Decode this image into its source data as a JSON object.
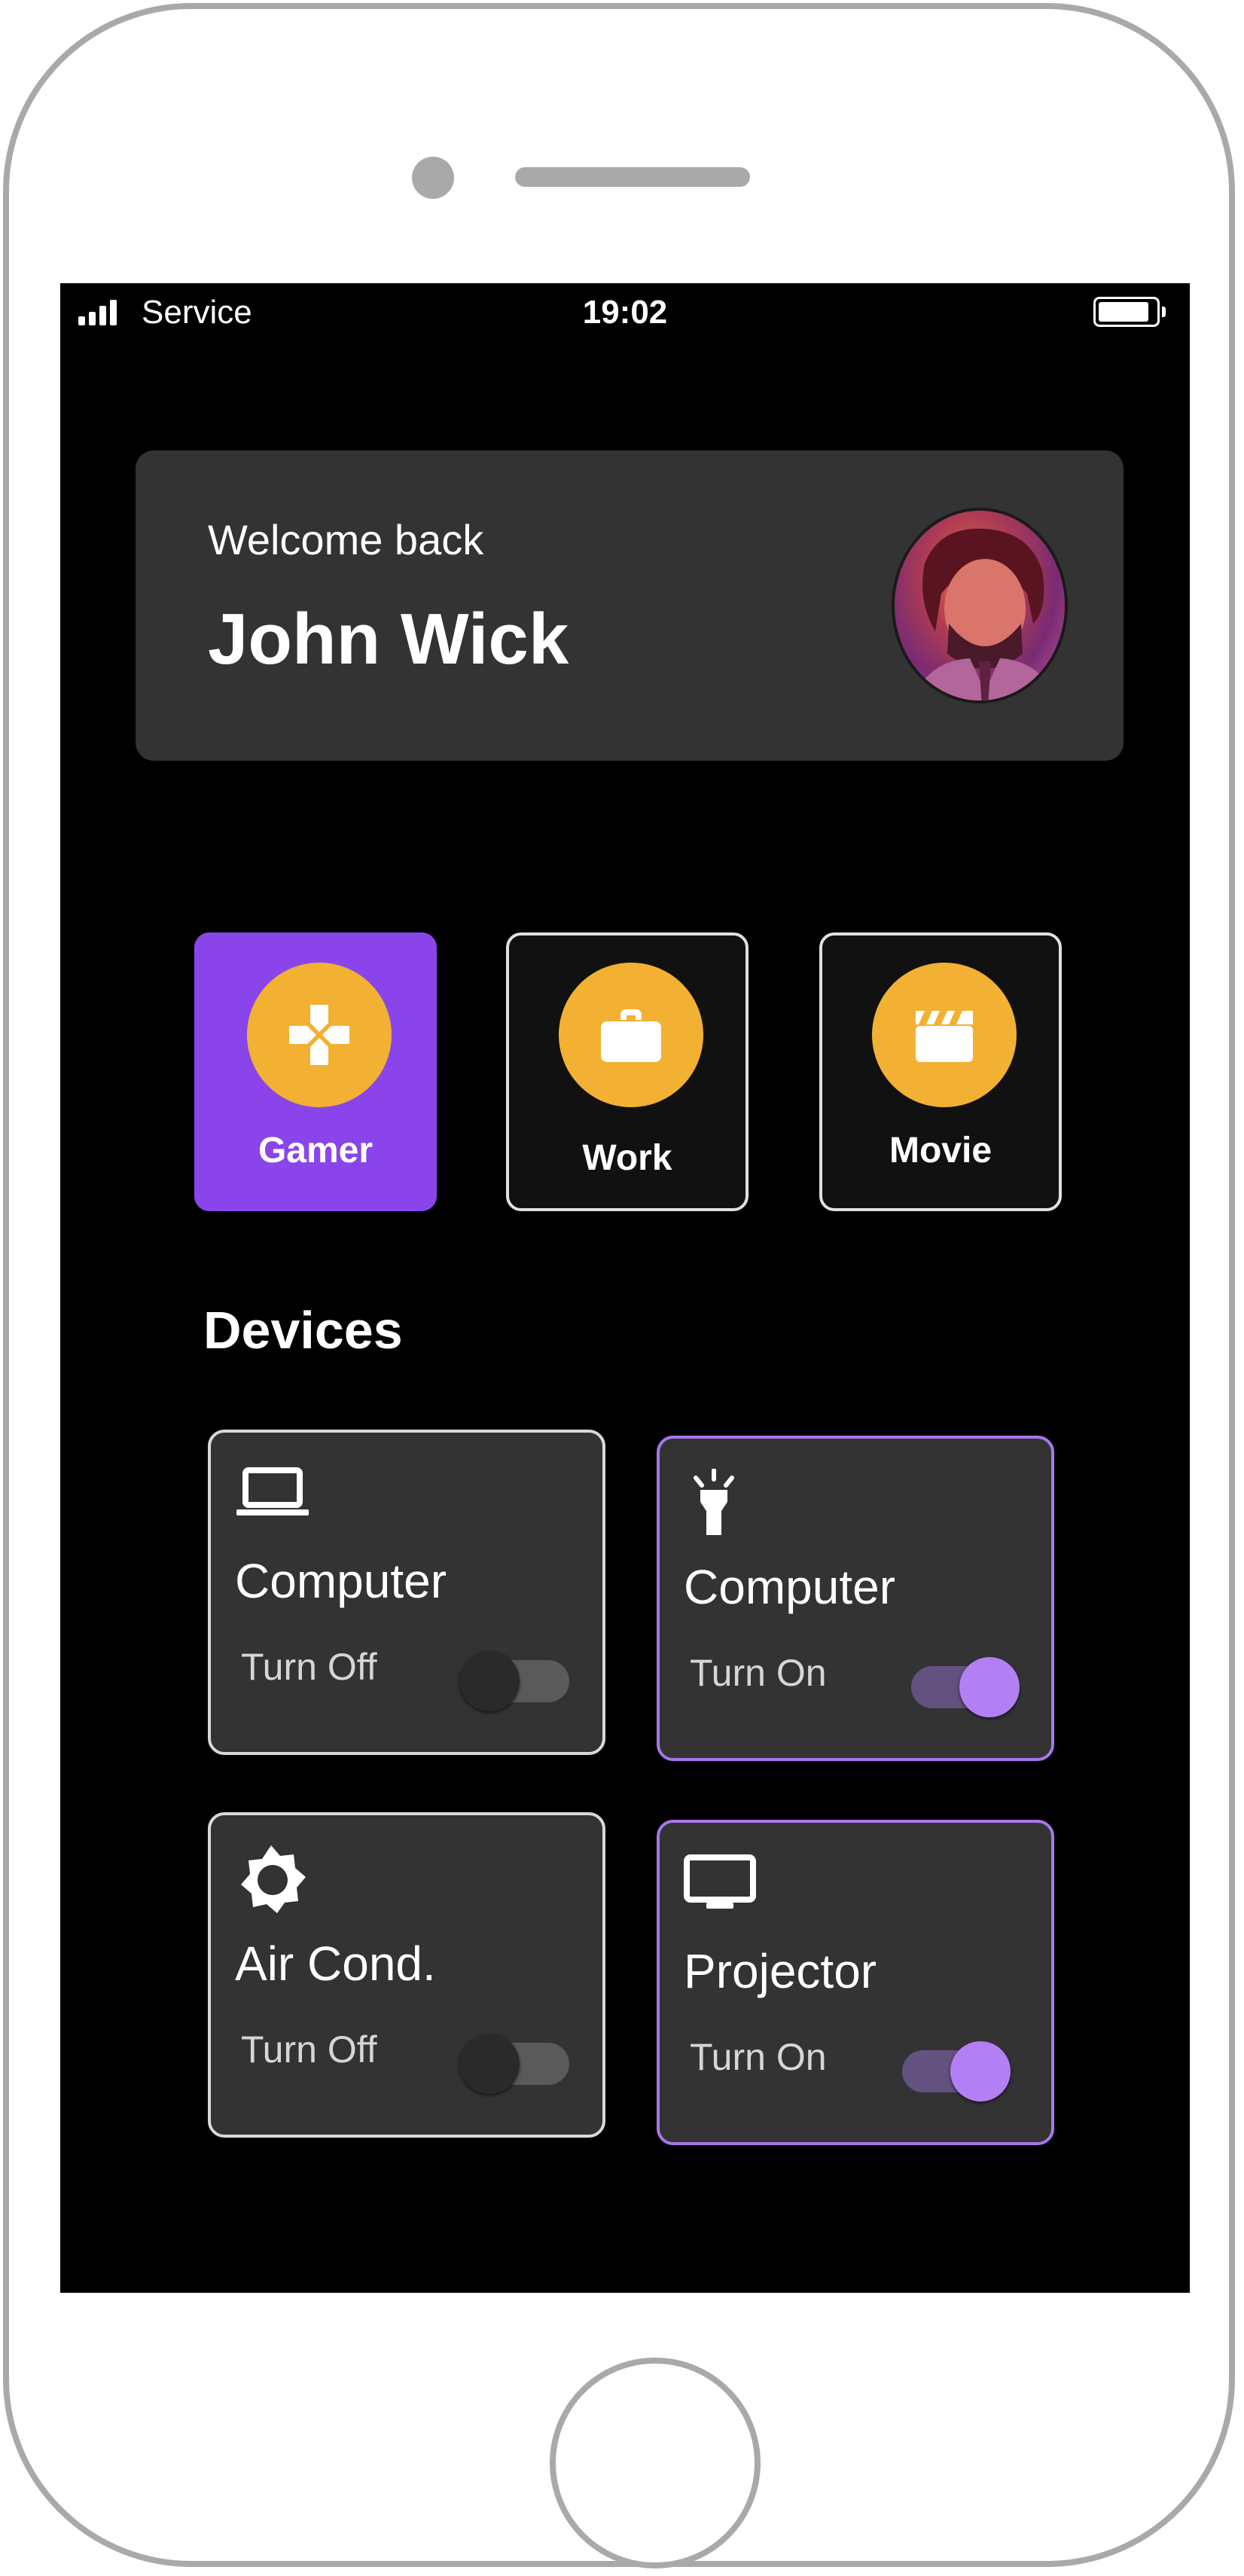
{
  "status_bar": {
    "carrier": "Service",
    "time": "19:02"
  },
  "welcome": {
    "greeting": "Welcome back",
    "name": "John Wick"
  },
  "modes": [
    {
      "label": "Gamer",
      "icon": "gamepad-icon",
      "active": true
    },
    {
      "label": "Work",
      "icon": "briefcase-icon",
      "active": false
    },
    {
      "label": "Movie",
      "icon": "clapperboard-icon",
      "active": false
    }
  ],
  "devices_section": {
    "title": "Devices"
  },
  "devices": [
    {
      "name": "Computer",
      "state_label": "Turn Off",
      "on": false,
      "icon": "laptop-icon"
    },
    {
      "name": "Computer",
      "state_label": "Turn On",
      "on": true,
      "icon": "flashlight-icon"
    },
    {
      "name": "Air Cond.",
      "state_label": "Turn Off",
      "on": false,
      "icon": "sun-icon"
    },
    {
      "name": "Projector",
      "state_label": "Turn On",
      "on": true,
      "icon": "monitor-icon"
    }
  ],
  "colors": {
    "accent": "#8a45ea",
    "mode_icon_bg": "#f2b132",
    "toggle_on": "#b37ff5",
    "card_bg": "#333333"
  }
}
